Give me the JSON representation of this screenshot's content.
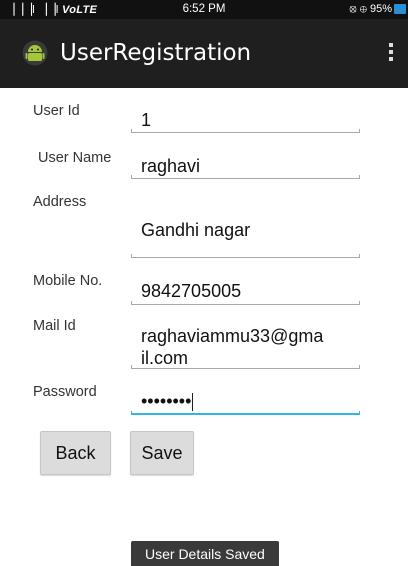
{
  "status_bar": {
    "signal": "▕▕▕l ▕▕l",
    "network": "VoLTE",
    "time": "6:52 PM",
    "indicators": "⦻ ⊕ 95%",
    "battery_color": "#2b8fd6"
  },
  "app": {
    "title": "UserRegistration",
    "icon": "android-icon",
    "menu_icon": "overflow-menu-icon"
  },
  "form": {
    "user_id": {
      "label": "User Id",
      "value": "1"
    },
    "user_name": {
      "label": "User Name",
      "value": "raghavi"
    },
    "address": {
      "label": "Address",
      "value": "Gandhi  nagar"
    },
    "mobile": {
      "label": "Mobile No.",
      "value": "9842705005"
    },
    "mail": {
      "label": "Mail Id",
      "value": "raghaviammu33@gma",
      "value2": "il.com"
    },
    "password": {
      "label": "Password",
      "value": "••••••••"
    }
  },
  "buttons": {
    "back": "Back",
    "save": "Save"
  },
  "toast": "User Details Saved",
  "colors": {
    "action_bar": "#1f1f1f",
    "focus_underline": "#33b5e5",
    "android_green": "#a4c639"
  }
}
